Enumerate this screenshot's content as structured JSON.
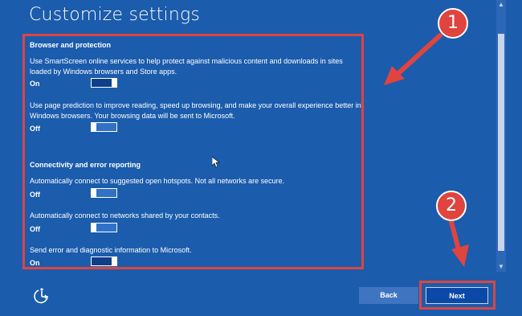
{
  "page": {
    "title": "Customize settings"
  },
  "sections": [
    {
      "heading": "Browser and protection",
      "items": [
        {
          "description": "Use SmartScreen online services to help protect against malicious content and downloads in sites loaded by Windows browsers and Store apps.",
          "state_label": "On",
          "enabled": true
        },
        {
          "description": "Use page prediction to improve reading, speed up browsing, and make your overall experience better in Windows browsers. Your browsing data will be sent to Microsoft.",
          "state_label": "Off",
          "enabled": false
        }
      ]
    },
    {
      "heading": "Connectivity and error reporting",
      "items": [
        {
          "description": "Automatically connect to suggested open hotspots. Not all networks are secure.",
          "state_label": "Off",
          "enabled": false
        },
        {
          "description": "Automatically connect to networks shared by your contacts.",
          "state_label": "Off",
          "enabled": false
        },
        {
          "description": "Send error and diagnostic information to Microsoft.",
          "state_label": "On",
          "enabled": true
        }
      ]
    }
  ],
  "buttons": {
    "back": "Back",
    "next": "Next"
  },
  "annotations": {
    "badge_1": "1",
    "badge_2": "2",
    "highlight_color": "#e0443e"
  },
  "colors": {
    "background": "#1b5cad",
    "next_button": "#0b48a8",
    "back_button": "#3f74c0"
  },
  "icons": {
    "ease_of_access": "ease-of-access-icon",
    "scroll_up": "chevron-up-icon",
    "scroll_down": "chevron-down-icon",
    "cursor": "mouse-cursor-icon"
  }
}
